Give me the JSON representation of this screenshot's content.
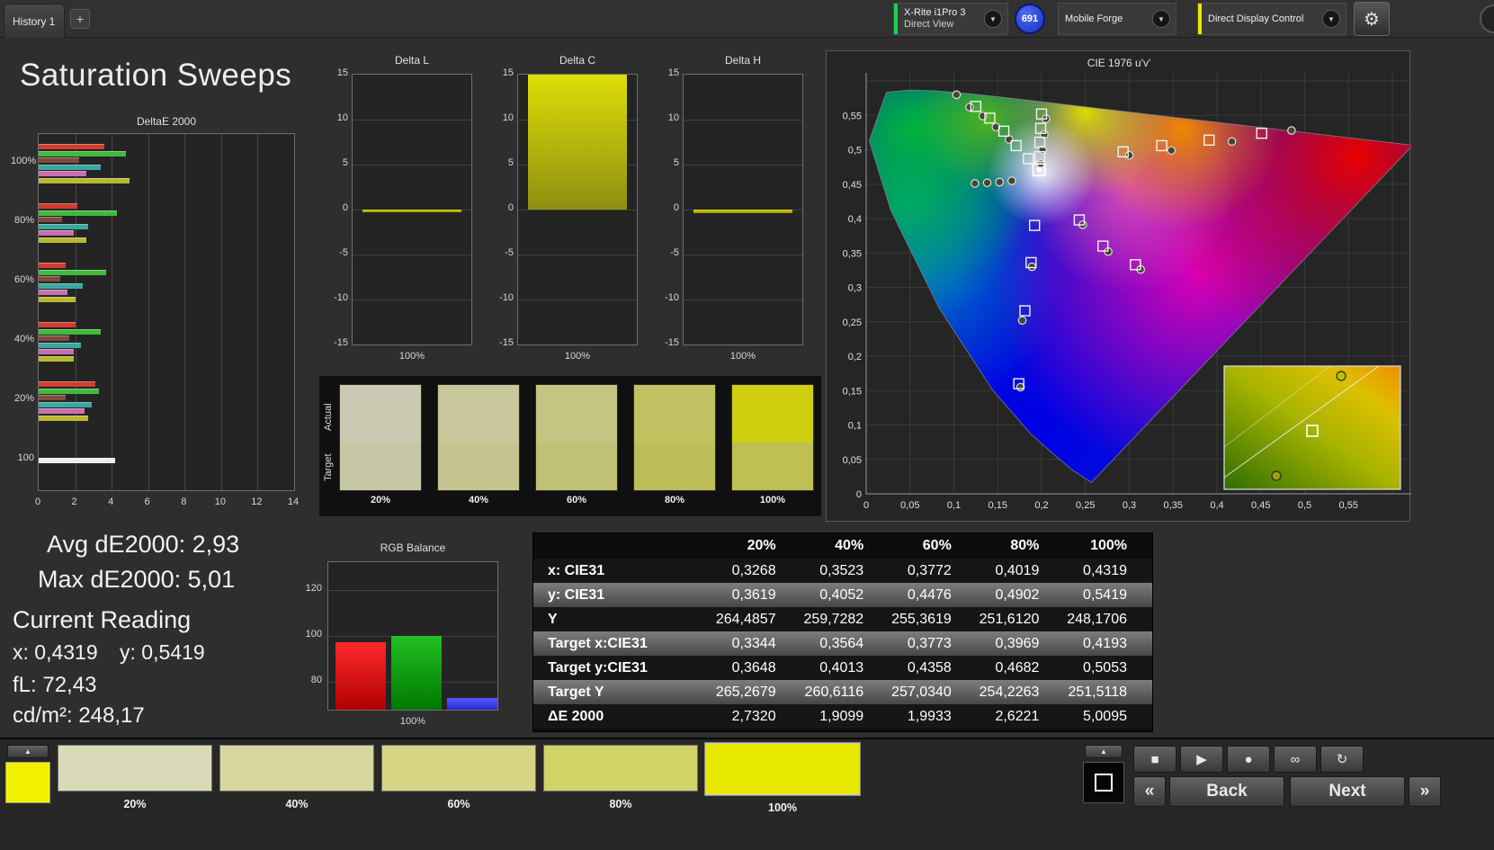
{
  "window": {
    "history_tab": "History 1",
    "add_tab": "+"
  },
  "topbar": {
    "meter_line1": "X-Rite i1Pro 3",
    "meter_line2": "Direct View",
    "meter_status_color": "#15d24a",
    "badge_count": "691",
    "source_label": "Mobile Forge",
    "display_control_label": "Direct Display Control",
    "display_control_status_color": "#e9e900"
  },
  "page_title": "Saturation Sweeps",
  "readouts": {
    "avg_de2000": "Avg dE2000: 2,93",
    "max_de2000": "Max dE2000: 5,01",
    "current_heading": "Current Reading",
    "current_x": "x: 0,4319",
    "current_y": "y: 0,5419",
    "current_fl": "fL: 72,43",
    "current_cdm2": "cd/m²: 248,17"
  },
  "swatch_strip": {
    "row_labels": [
      "Actual",
      "Target"
    ],
    "columns": [
      {
        "label": "20%",
        "actual": "#c9cab1",
        "target": "#c6c7a5"
      },
      {
        "label": "40%",
        "actual": "#c7c79b",
        "target": "#c4c48f"
      },
      {
        "label": "60%",
        "actual": "#c5c581",
        "target": "#c1c175"
      },
      {
        "label": "80%",
        "actual": "#c2c263",
        "target": "#bebe58"
      },
      {
        "label": "100%",
        "actual": "#cfcf10",
        "target": "#bfbf52"
      }
    ]
  },
  "chart_data": [
    {
      "id": "deltaE2000",
      "type": "bar",
      "orientation": "horizontal",
      "title": "DeltaE 2000",
      "xlim": [
        0,
        14
      ],
      "xticks": [
        0,
        2,
        4,
        6,
        8,
        10,
        12,
        14
      ],
      "groups": [
        {
          "label": "100%",
          "bars": [
            {
              "color": "#d23b2f",
              "value": 3.6
            },
            {
              "color": "#3fba3c",
              "value": 4.8
            },
            {
              "color": "#7e4a3c",
              "value": 2.2
            },
            {
              "color": "#3aa7a0",
              "value": 3.4
            },
            {
              "color": "#c86fae",
              "value": 2.6
            },
            {
              "color": "#b9b92e",
              "value": 5.0
            }
          ]
        },
        {
          "label": "80%",
          "bars": [
            {
              "color": "#d23b2f",
              "value": 2.1
            },
            {
              "color": "#3fba3c",
              "value": 4.3
            },
            {
              "color": "#7e4a3c",
              "value": 1.3
            },
            {
              "color": "#3aa7a0",
              "value": 2.7
            },
            {
              "color": "#c86fae",
              "value": 1.9
            },
            {
              "color": "#b9b92e",
              "value": 2.6
            }
          ]
        },
        {
          "label": "60%",
          "bars": [
            {
              "color": "#d23b2f",
              "value": 1.5
            },
            {
              "color": "#3fba3c",
              "value": 3.7
            },
            {
              "color": "#7e4a3c",
              "value": 1.2
            },
            {
              "color": "#3aa7a0",
              "value": 2.4
            },
            {
              "color": "#c86fae",
              "value": 1.6
            },
            {
              "color": "#b9b92e",
              "value": 2.0
            }
          ]
        },
        {
          "label": "40%",
          "bars": [
            {
              "color": "#d23b2f",
              "value": 2.0
            },
            {
              "color": "#3fba3c",
              "value": 3.4
            },
            {
              "color": "#7e4a3c",
              "value": 1.7
            },
            {
              "color": "#3aa7a0",
              "value": 2.3
            },
            {
              "color": "#c86fae",
              "value": 1.9
            },
            {
              "color": "#b9b92e",
              "value": 1.9
            }
          ]
        },
        {
          "label": "20%",
          "bars": [
            {
              "color": "#d23b2f",
              "value": 3.1
            },
            {
              "color": "#3fba3c",
              "value": 3.3
            },
            {
              "color": "#7e4a3c",
              "value": 1.5
            },
            {
              "color": "#3aa7a0",
              "value": 2.9
            },
            {
              "color": "#c86fae",
              "value": 2.5
            },
            {
              "color": "#b9b92e",
              "value": 2.7
            }
          ]
        },
        {
          "label": "100",
          "bars": [
            {
              "color": "#ececec",
              "value": 4.2
            }
          ]
        }
      ],
      "stats": {
        "avg_de2000": 2.93,
        "max_de2000": 5.01
      }
    },
    {
      "id": "delta_l",
      "type": "bar",
      "title": "Delta L",
      "category": "100%",
      "ylim": [
        -15,
        15
      ],
      "yticks": [
        15,
        10,
        5,
        0,
        -5,
        -10,
        -15
      ],
      "value": -0.3,
      "clipped": false
    },
    {
      "id": "delta_c",
      "type": "bar",
      "title": "Delta C",
      "category": "100%",
      "ylim": [
        -15,
        15
      ],
      "yticks": [
        15,
        10,
        5,
        0,
        -5,
        -10,
        -15
      ],
      "value": 15,
      "clipped": true
    },
    {
      "id": "delta_h",
      "type": "bar",
      "title": "Delta H",
      "category": "100%",
      "ylim": [
        -15,
        15
      ],
      "yticks": [
        15,
        10,
        5,
        0,
        -5,
        -10,
        -15
      ],
      "value": -0.4,
      "clipped": false
    },
    {
      "id": "cie_1976",
      "type": "scatter",
      "title": "CIE 1976 u'v'",
      "xlim": [
        0,
        0.62
      ],
      "ylim": [
        0,
        0.61
      ],
      "tick_step": 0.05,
      "tick_max": 0.55,
      "spectral_locus_uv": [
        [
          0.6234,
          0.5065
        ],
        [
          0.5202,
          0.5219
        ],
        [
          0.4035,
          0.5393
        ],
        [
          0.3315,
          0.5501
        ],
        [
          0.2623,
          0.5604
        ],
        [
          0.2026,
          0.5694
        ],
        [
          0.1531,
          0.5766
        ],
        [
          0.1127,
          0.5821
        ],
        [
          0.0792,
          0.5856
        ],
        [
          0.0501,
          0.5868
        ],
        [
          0.0231,
          0.5837
        ],
        [
          0.0035,
          0.5131
        ],
        [
          0.0282,
          0.4117
        ],
        [
          0.0828,
          0.2708
        ],
        [
          0.1441,
          0.151
        ],
        [
          0.1877,
          0.0871
        ],
        [
          0.2161,
          0.0549
        ],
        [
          0.2347,
          0.035
        ],
        [
          0.2568,
          0.0165
        ]
      ],
      "targets_uv": [
        [
          0.125,
          0.563
        ],
        [
          0.141,
          0.546
        ],
        [
          0.157,
          0.527
        ],
        [
          0.171,
          0.506
        ],
        [
          0.185,
          0.487
        ],
        [
          0.2,
          0.552
        ],
        [
          0.199,
          0.531
        ],
        [
          0.198,
          0.511
        ],
        [
          0.198,
          0.49
        ],
        [
          0.293,
          0.497
        ],
        [
          0.337,
          0.506
        ],
        [
          0.391,
          0.514
        ],
        [
          0.451,
          0.524
        ],
        [
          0.192,
          0.39
        ],
        [
          0.188,
          0.336
        ],
        [
          0.181,
          0.266
        ],
        [
          0.174,
          0.16
        ],
        [
          0.243,
          0.398
        ],
        [
          0.27,
          0.36
        ],
        [
          0.307,
          0.333
        ]
      ],
      "measurements_uv": [
        [
          0.103,
          0.58
        ],
        [
          0.118,
          0.562
        ],
        [
          0.133,
          0.549
        ],
        [
          0.148,
          0.533
        ],
        [
          0.163,
          0.515
        ],
        [
          0.124,
          0.451
        ],
        [
          0.138,
          0.452
        ],
        [
          0.152,
          0.453
        ],
        [
          0.166,
          0.455
        ],
        [
          0.205,
          0.545
        ],
        [
          0.203,
          0.522
        ],
        [
          0.201,
          0.5
        ],
        [
          0.199,
          0.48
        ],
        [
          0.3,
          0.492
        ],
        [
          0.348,
          0.499
        ],
        [
          0.417,
          0.512
        ],
        [
          0.485,
          0.528
        ],
        [
          0.247,
          0.391
        ],
        [
          0.276,
          0.352
        ],
        [
          0.313,
          0.326
        ],
        [
          0.189,
          0.33
        ],
        [
          0.178,
          0.252
        ],
        [
          0.176,
          0.155
        ]
      ],
      "current_uv": [
        0.197,
        0.471
      ]
    },
    {
      "id": "rgb_balance",
      "type": "bar",
      "title": "RGB Balance",
      "xlabel": "100%",
      "categories": [
        "R",
        "G",
        "B"
      ],
      "values": [
        97.3,
        100,
        73
      ],
      "colors": [
        "#ff2a2a",
        "#22c022",
        "#5858ff"
      ],
      "colors_dark": [
        "#b00000",
        "#007800",
        "#2a2ac8"
      ],
      "ylim": [
        68,
        132
      ],
      "yticks": [
        120,
        100,
        80
      ]
    },
    {
      "id": "results_table",
      "type": "table",
      "columns": [
        "20%",
        "40%",
        "60%",
        "80%",
        "100%"
      ],
      "rows": [
        {
          "label": "x: CIE31",
          "values": [
            "0,3268",
            "0,3523",
            "0,3772",
            "0,4019",
            "0,4319"
          ]
        },
        {
          "label": "y: CIE31",
          "values": [
            "0,3619",
            "0,4052",
            "0,4476",
            "0,4902",
            "0,5419"
          ]
        },
        {
          "label": "Y",
          "values": [
            "264,4857",
            "259,7282",
            "255,3619",
            "251,6120",
            "248,1706"
          ]
        },
        {
          "label": "Target x:CIE31",
          "values": [
            "0,3344",
            "0,3564",
            "0,3773",
            "0,3969",
            "0,4193"
          ]
        },
        {
          "label": "Target y:CIE31",
          "values": [
            "0,3648",
            "0,4013",
            "0,4358",
            "0,4682",
            "0,5053"
          ]
        },
        {
          "label": "Target Y",
          "values": [
            "265,2679",
            "260,6116",
            "257,0340",
            "254,2263",
            "251,5118"
          ]
        },
        {
          "label": "ΔE 2000",
          "values": [
            "2,7320",
            "1,9099",
            "1,9933",
            "2,6221",
            "5,0095"
          ]
        }
      ]
    }
  ],
  "bottombar": {
    "mini_swatch_color": "#f2f200",
    "patches": [
      {
        "label": "20%",
        "color": "#dadab9",
        "active": false
      },
      {
        "label": "40%",
        "color": "#d7d79f",
        "active": false
      },
      {
        "label": "60%",
        "color": "#d5d584",
        "active": false
      },
      {
        "label": "80%",
        "color": "#d2d266",
        "active": false
      },
      {
        "label": "100%",
        "color": "#e9e900",
        "active": true
      }
    ],
    "transport": [
      {
        "name": "stop",
        "glyph": "■"
      },
      {
        "name": "play",
        "glyph": "▶"
      },
      {
        "name": "measure",
        "glyph": "●"
      },
      {
        "name": "continuous",
        "glyph": "∞"
      },
      {
        "name": "loop",
        "glyph": "↻"
      }
    ],
    "prev_glyph": "«",
    "back_label": "Back",
    "next_label": "Next",
    "next_glyph": "»",
    "up_glyph": "▲"
  }
}
